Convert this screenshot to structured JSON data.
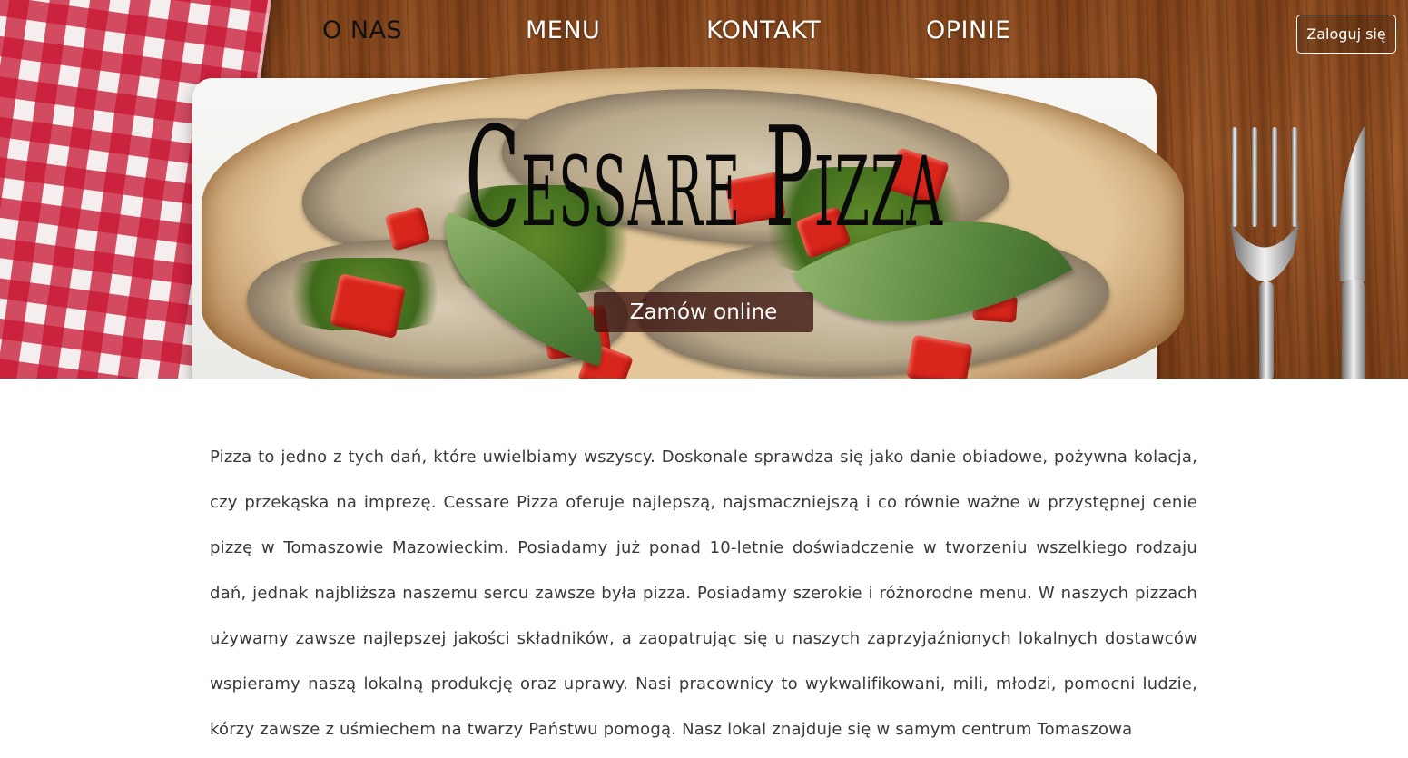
{
  "nav": {
    "items": [
      {
        "label": "O NAS"
      },
      {
        "label": "MENU"
      },
      {
        "label": "KONTAKT"
      },
      {
        "label": "OPINIE"
      }
    ],
    "login_label": "Zaloguj się"
  },
  "hero": {
    "brand": "Cessare Pizza",
    "order_label": "Zamów online"
  },
  "about": {
    "text": "Pizza to jedno z tych dań, które uwielbiamy wszyscy. Doskonale sprawdza się jako danie obiadowe, pożywna kolacja, czy przekąska na imprezę. Cessare Pizza oferuje najlepszą, najsmaczniejszą i co równie ważne w przystępnej cenie pizzę w Tomaszowie Mazowieckim. Posiadamy już ponad 10-letnie doświadczenie w tworzeniu wszelkiego rodzaju dań, jednak najbliższa naszemu sercu zawsze była pizza. Posiadamy szerokie i różnorodne menu. W naszych pizzach używamy zawsze najlepszej jakości składników, a zaopatrując się u naszych zaprzyjaźnionych lokalnych dostawców wspieramy naszą lokalną produkcję oraz uprawy. Nasi pracownicy to wykwalifikowani, mili, młodzi, pomocni ludzie, kórzy zawsze z uśmiechem na twarzy Państwu pomogą. Nasz lokal znajduje się w samym centrum Tomaszowa"
  }
}
